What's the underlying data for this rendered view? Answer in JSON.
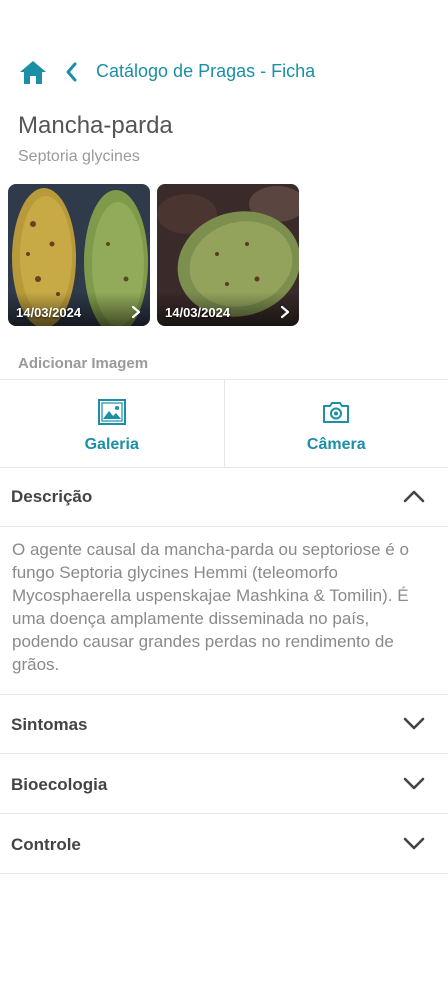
{
  "header": {
    "title": "Catálogo de Pragas - Ficha",
    "home_icon": "home-icon",
    "back_icon": "chevron-left-icon",
    "accent_color": "#1a8fa6"
  },
  "pest": {
    "name": "Mancha-parda",
    "scientific_name": "Septoria glycines"
  },
  "images": [
    {
      "date": "14/03/2024"
    },
    {
      "date": "14/03/2024"
    }
  ],
  "add_image": {
    "label": "Adicionar Imagem",
    "gallery_label": "Galeria",
    "camera_label": "Câmera"
  },
  "sections": {
    "description": {
      "title": "Descrição",
      "expanded": true,
      "text": "O agente causal da mancha-parda ou septoriose é o fungo Septoria glycines Hemmi (teleomorfo Mycosphaerella uspenskajae Mashkina & Tomilin). É uma doença amplamente disseminada no país, podendo causar grandes perdas no rendimento de grãos."
    },
    "symptoms": {
      "title": "Sintomas",
      "expanded": false
    },
    "bioecology": {
      "title": "Bioecologia",
      "expanded": false
    },
    "control": {
      "title": "Controle",
      "expanded": false
    }
  }
}
